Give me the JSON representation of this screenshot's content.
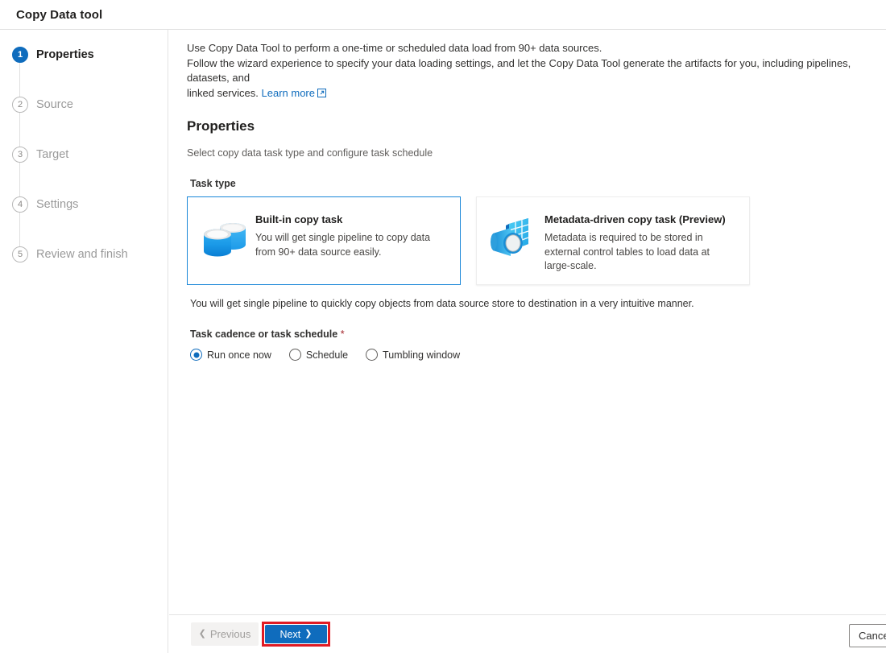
{
  "window": {
    "title": "Copy Data tool"
  },
  "sidebar": {
    "steps": [
      {
        "number": "1",
        "label": "Properties",
        "state": "active"
      },
      {
        "number": "2",
        "label": "Source",
        "state": "inactive"
      },
      {
        "number": "3",
        "label": "Target",
        "state": "inactive"
      },
      {
        "number": "4",
        "label": "Settings",
        "state": "inactive"
      },
      {
        "number": "5",
        "label": "Review and finish",
        "state": "inactive"
      }
    ]
  },
  "main": {
    "intro_line1": "Use Copy Data Tool to perform a one-time or scheduled data load from 90+ data sources.",
    "intro_line2": "Follow the wizard experience to specify your data loading settings, and let the Copy Data Tool generate the artifacts for you, including pipelines, datasets, and",
    "intro_line3_prefix": "linked services.",
    "learn_more_label": "Learn more",
    "section_title": "Properties",
    "section_subtitle": "Select copy data task type and configure task schedule",
    "task_type_label": "Task type",
    "cards": [
      {
        "title": "Built-in copy task",
        "description": "You will get single pipeline to copy data from 90+ data source easily.",
        "icon": "database-cylinders-icon",
        "selected": true
      },
      {
        "title": "Metadata-driven copy task (Preview)",
        "description": "Metadata is required to be stored in external control tables to load data at large-scale.",
        "icon": "metadata-table-magnifier-icon",
        "selected": false
      }
    ],
    "cards_note": "You will get single pipeline to quickly copy objects from data source store to destination in a very intuitive manner.",
    "cadence_label": "Task cadence or task schedule",
    "cadence_required_marker": "*",
    "cadence_options": [
      {
        "label": "Run once now",
        "checked": true
      },
      {
        "label": "Schedule",
        "checked": false
      },
      {
        "label": "Tumbling window",
        "checked": false
      }
    ]
  },
  "footer": {
    "previous_label": "Previous",
    "next_label": "Next",
    "cancel_label": "Cancel"
  },
  "colors": {
    "accent": "#0f6cbd",
    "selected_card_border": "#1a87d8",
    "highlight_box": "#e01b24",
    "required_star": "#a4262c"
  }
}
